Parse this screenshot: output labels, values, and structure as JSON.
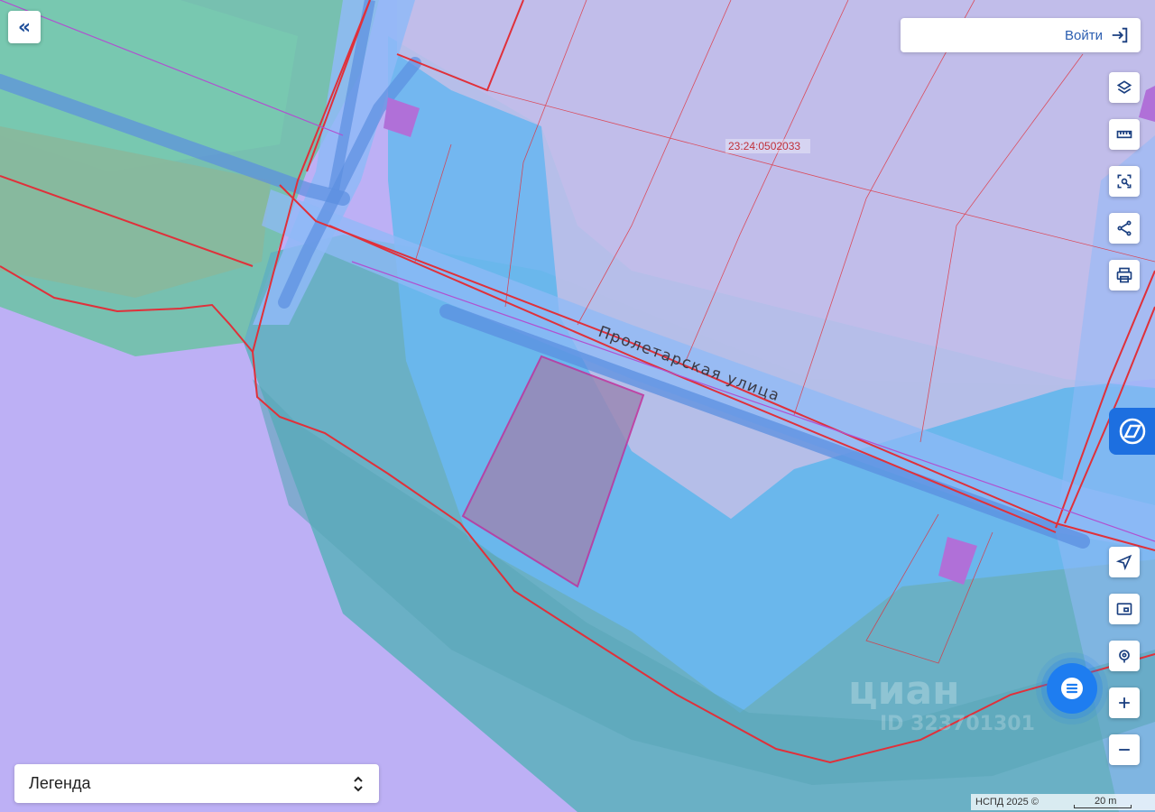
{
  "map": {
    "street_name": "Пролетарская улица",
    "cadastral_number": "23:24:0502033"
  },
  "header": {
    "login_label": "Войти",
    "collapse_icon": "double-chevron-left-icon"
  },
  "toolbar": {
    "top_buttons": [
      "layers-icon",
      "ruler-icon",
      "area-select-icon",
      "share-icon",
      "print-icon"
    ],
    "bottom_buttons": [
      "locate-arrow-icon",
      "minimap-icon",
      "geolocation-icon",
      "zoom-in-icon",
      "zoom-out-icon"
    ]
  },
  "legend": {
    "label": "Легенда"
  },
  "watermark": {
    "brand": "циан",
    "id_text": "ID 323701301"
  },
  "attribution": {
    "text": "НСПД 2025 ©",
    "scale": "20 m"
  },
  "colors": {
    "background_violet": "#bdb0f5",
    "water_blue": "#6fb8ee",
    "teal_zone": "#5fb3b8",
    "parcel_border_red": "#e0303a",
    "selected_parcel": "#9a88b5",
    "accent_blue": "#1e7df0"
  }
}
